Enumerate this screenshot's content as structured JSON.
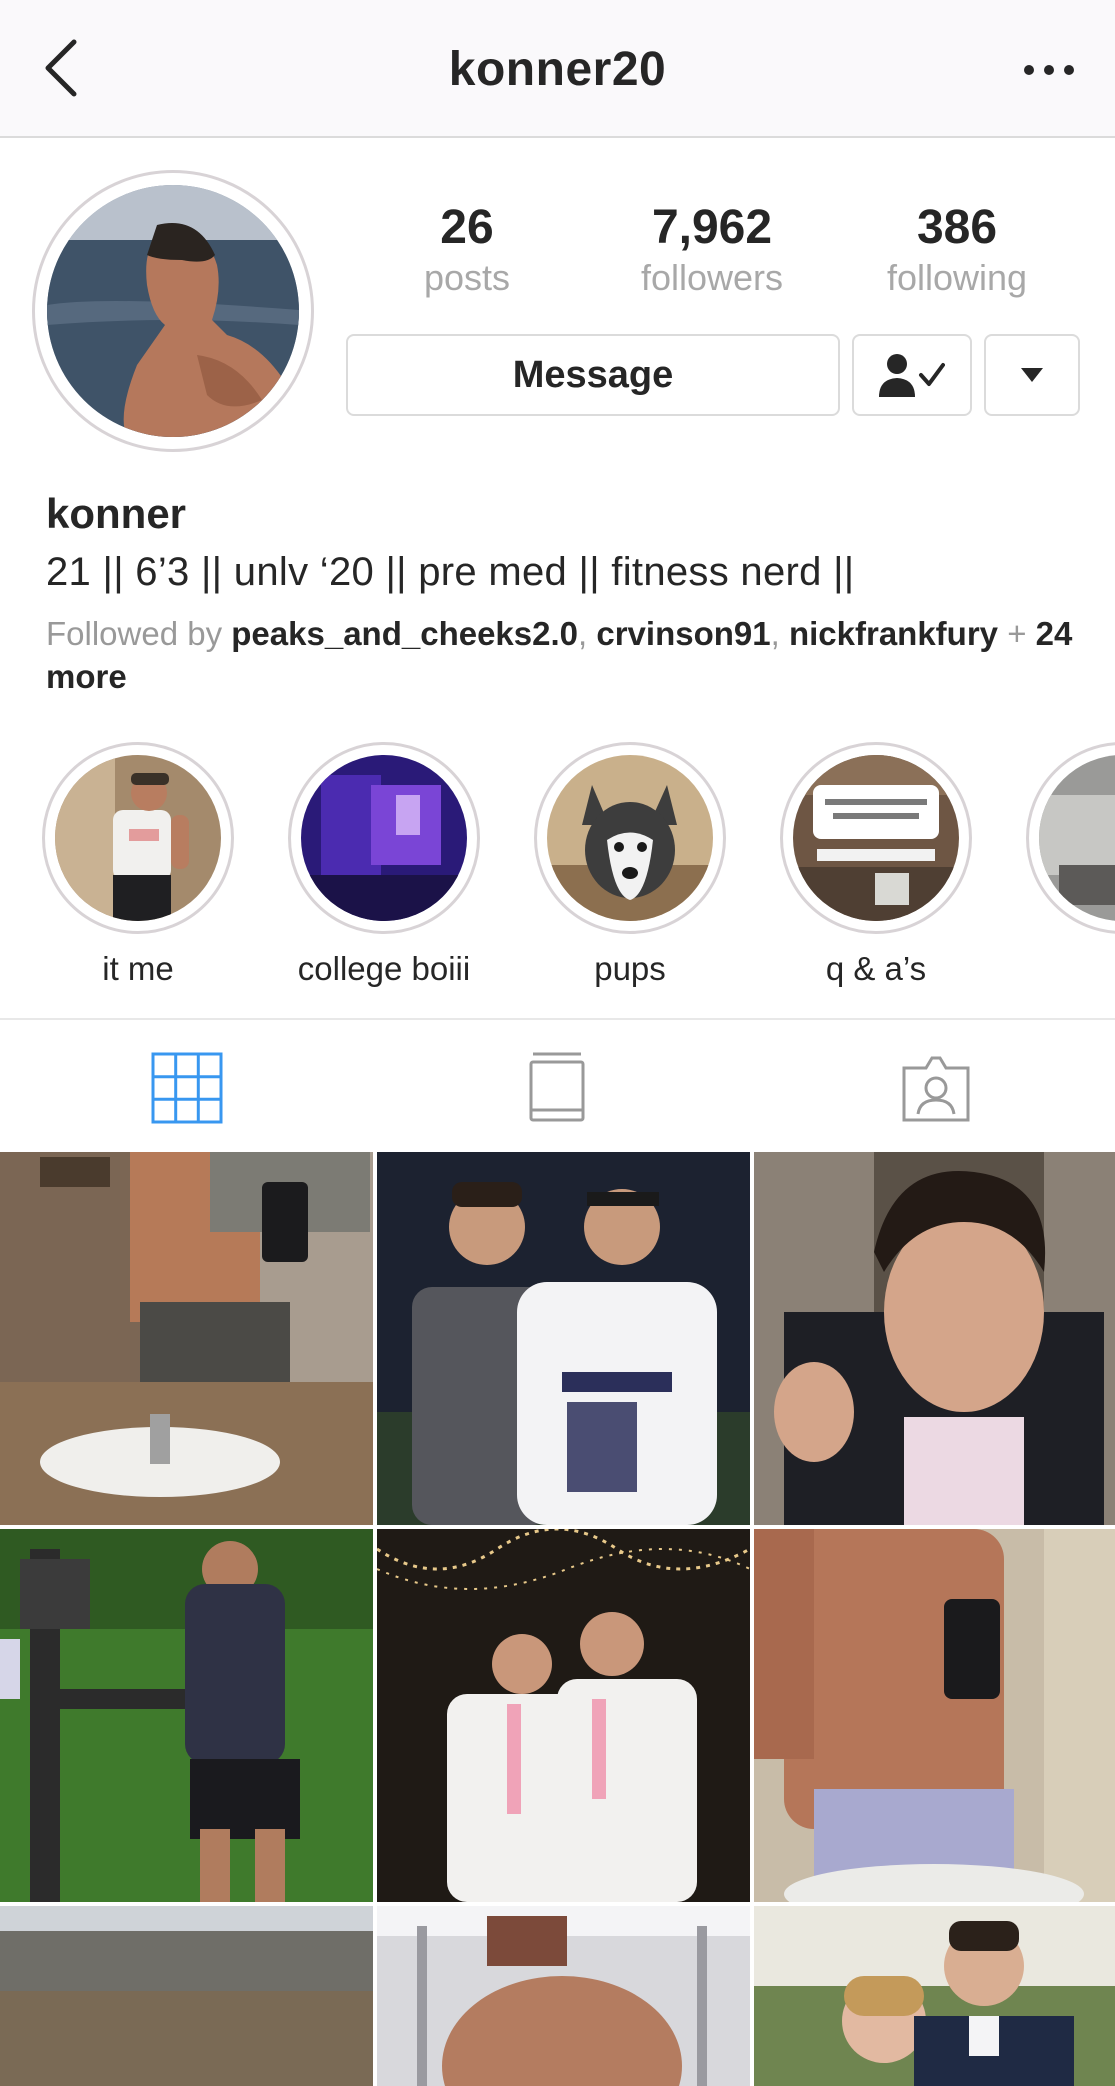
{
  "header": {
    "title": "konner20",
    "back_icon": "chevron-left-icon",
    "more_icon": "more-horizontal-icon"
  },
  "profile": {
    "stats": [
      {
        "value": "26",
        "label": "posts"
      },
      {
        "value": "7,962",
        "label": "followers"
      },
      {
        "value": "386",
        "label": "following"
      }
    ],
    "message_label": "Message",
    "following_icon": "person-check-icon",
    "dropdown_icon": "triangle-down-icon",
    "name": "konner",
    "bio": "21 || 6’3 || unlv ‘20 || pre med || fitness nerd ||",
    "followed_by": {
      "prefix": "Followed by ",
      "users": [
        "peaks_and_cheeks2.0",
        "crvinson91",
        "nickfrankfury"
      ],
      "more": "24 more"
    }
  },
  "highlights": [
    {
      "label": "it me"
    },
    {
      "label": "college boiii"
    },
    {
      "label": "pups"
    },
    {
      "label": "q & a’s"
    },
    {
      "label": ""
    }
  ],
  "tabs": [
    {
      "name": "grid",
      "icon": "grid-icon",
      "active": true
    },
    {
      "name": "igtv",
      "icon": "igtv-icon",
      "active": false
    },
    {
      "name": "tagged",
      "icon": "tagged-person-icon",
      "active": false
    }
  ],
  "colors": {
    "accent_blue": "#3897f0",
    "text": "#262626",
    "muted": "#a8a8a8",
    "border": "#dbdbdb"
  }
}
